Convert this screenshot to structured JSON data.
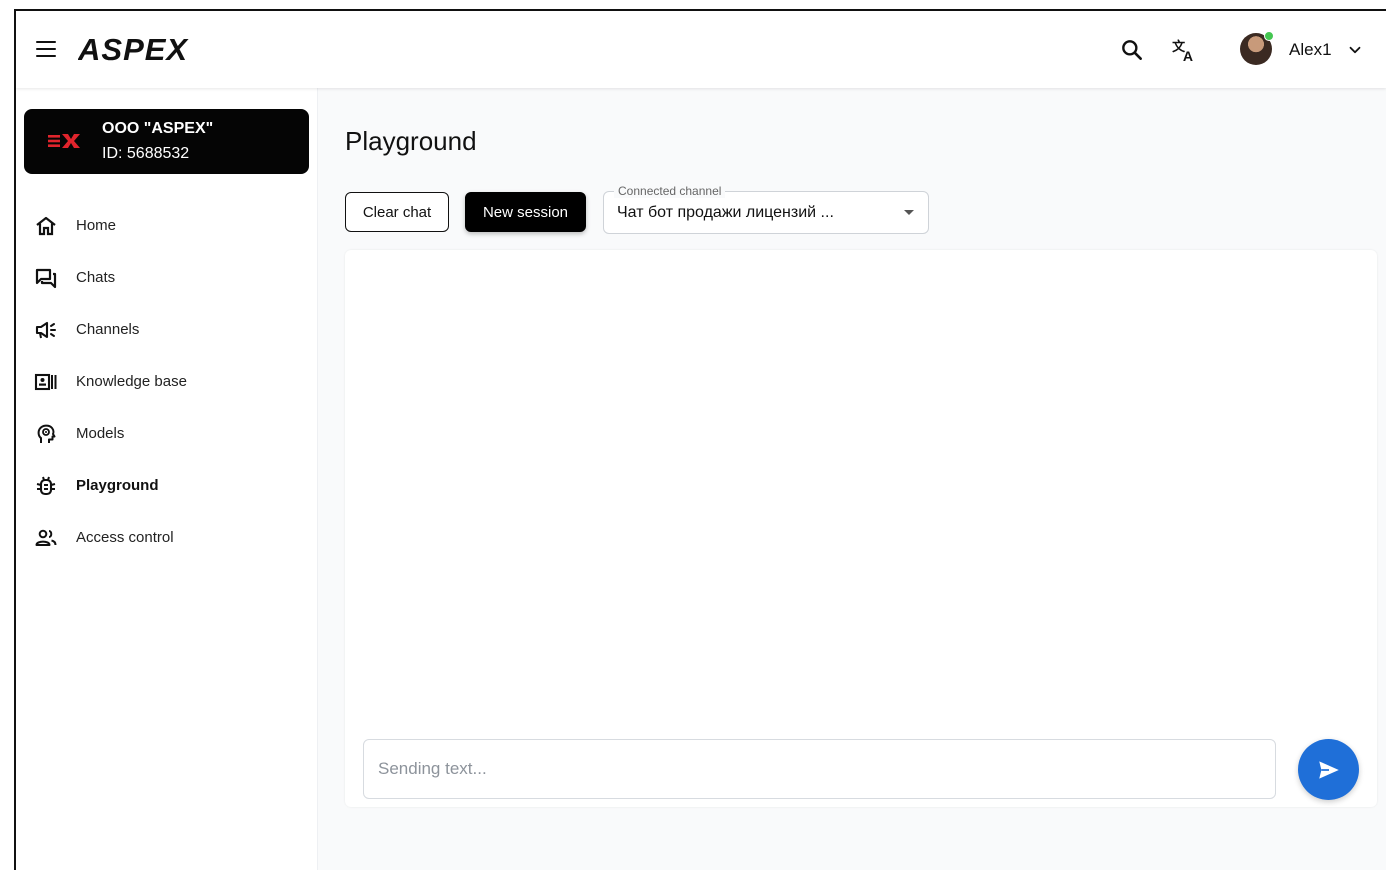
{
  "header": {
    "brand": "ASPEX",
    "user_name": "Alex1",
    "icons": [
      "menu-icon",
      "search-icon",
      "translate-icon",
      "chevron-down-icon"
    ]
  },
  "org": {
    "name": "ООО \"ASPEX\"",
    "id": "ID: 5688532"
  },
  "sidebar": {
    "items": [
      {
        "label": "Home",
        "icon": "home-icon"
      },
      {
        "label": "Chats",
        "icon": "chats-icon"
      },
      {
        "label": "Channels",
        "icon": "megaphone-icon"
      },
      {
        "label": "Knowledge base",
        "icon": "knowledge-base-icon"
      },
      {
        "label": "Models",
        "icon": "brain-head-icon"
      },
      {
        "label": "Playground",
        "icon": "bug-icon",
        "active": true
      },
      {
        "label": "Access control",
        "icon": "people-icon"
      }
    ]
  },
  "main": {
    "title": "Playground",
    "clear_label": "Clear chat",
    "new_session_label": "New session",
    "channel_select": {
      "label": "Connected channel",
      "value": "Чат бот продажи лицензий ..."
    },
    "input_placeholder": "Sending text..."
  },
  "colors": {
    "accent": "#1f6fd8",
    "online": "#44c651",
    "logo_red": "#e0242c"
  }
}
